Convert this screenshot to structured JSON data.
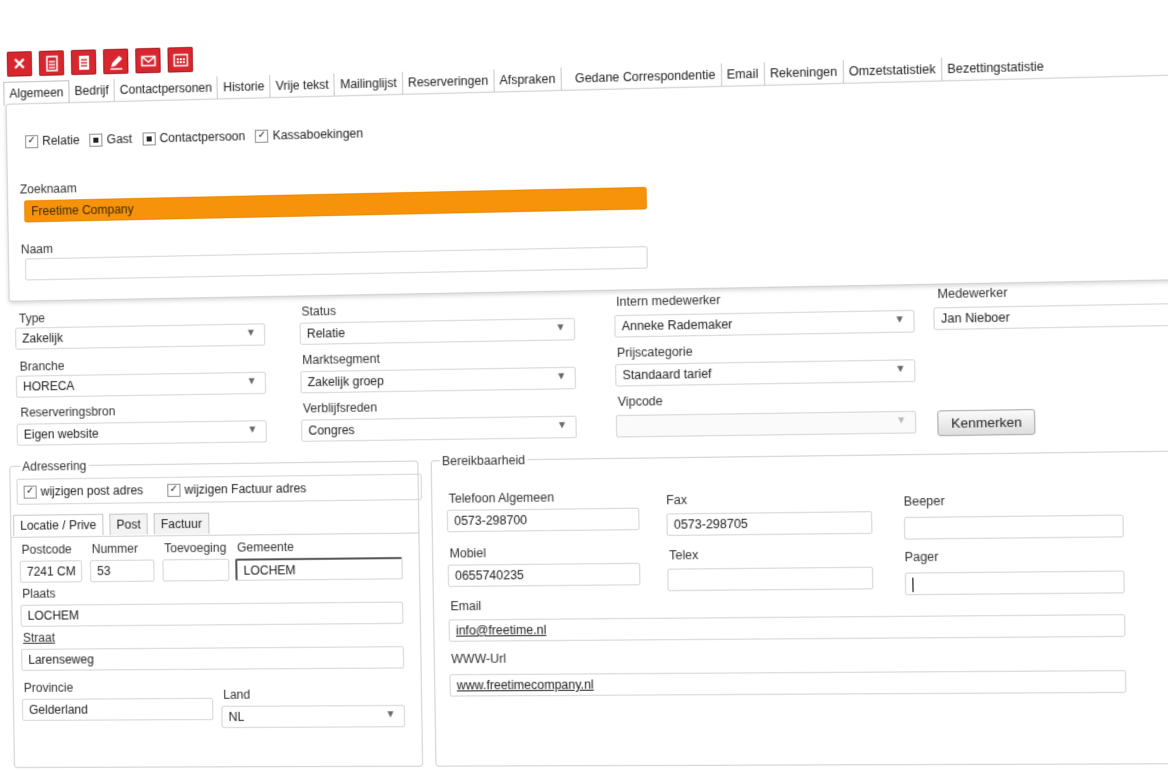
{
  "toolbar": {
    "buttons": [
      {
        "icon": "close-icon"
      },
      {
        "icon": "document-icon"
      },
      {
        "icon": "document-lines-icon"
      },
      {
        "icon": "edit-icon"
      },
      {
        "icon": "email-icon"
      },
      {
        "icon": "calendar-icon"
      }
    ]
  },
  "tabs": [
    "Algemeen",
    "Bedrijf",
    "Contactpersonen",
    "Historie",
    "Vrije tekst",
    "Mailinglijst",
    "Reserveringen",
    "Afspraken",
    "Gedane Correspondentie",
    "Email",
    "Rekeningen",
    "Omzetstatistiek",
    "Bezettingstatistie"
  ],
  "checks": {
    "relatie": {
      "label": "Relatie",
      "state": "checked"
    },
    "gast": {
      "label": "Gast",
      "state": "indeterminate"
    },
    "contactpersoon": {
      "label": "Contactpersoon",
      "state": "indeterminate"
    },
    "kassaboekingen": {
      "label": "Kassaboekingen",
      "state": "checked"
    }
  },
  "zoeknaam": {
    "label": "Zoeknaam",
    "value": "Freetime Company"
  },
  "naam": {
    "label": "Naam",
    "value": ""
  },
  "type": {
    "label": "Type",
    "value": "Zakelijk"
  },
  "status": {
    "label": "Status",
    "value": "Relatie"
  },
  "intern": {
    "label": "Intern medewerker",
    "value": "Anneke Rademaker"
  },
  "medewerker": {
    "label": "Medewerker",
    "value": "Jan Nieboer"
  },
  "branche": {
    "label": "Branche",
    "value": "HORECA"
  },
  "marktsegment": {
    "label": "Marktsegment",
    "value": "Zakelijk groep"
  },
  "prijscategorie": {
    "label": "Prijscategorie",
    "value": "Standaard tarief"
  },
  "reserveringsbron": {
    "label": "Reserveringsbron",
    "value": "Eigen website"
  },
  "verblijfsreden": {
    "label": "Verblijfsreden",
    "value": "Congres"
  },
  "vipcode": {
    "label": "Vipcode",
    "value": ""
  },
  "kenmerken_label": "Kenmerken",
  "adressering": {
    "title": "Adressering",
    "wijzigen_post": "wijzigen post adres",
    "wijzigen_factuur": "wijzigen Factuur adres",
    "subtabs": [
      "Locatie / Prive",
      "Post",
      "Factuur"
    ],
    "postcode": {
      "label": "Postcode",
      "value": "7241 CM"
    },
    "nummer": {
      "label": "Nummer",
      "value": "53"
    },
    "toevoeging": {
      "label": "Toevoeging",
      "value": ""
    },
    "gemeente": {
      "label": "Gemeente",
      "value": "LOCHEM"
    },
    "plaats": {
      "label": "Plaats",
      "value": "LOCHEM"
    },
    "straat": {
      "label": "Straat",
      "value": "Larenseweg"
    },
    "provincie": {
      "label": "Provincie",
      "value": "Gelderland"
    },
    "land": {
      "label": "Land",
      "value": "NL"
    }
  },
  "bereikbaarheid": {
    "title": "Bereikbaarheid",
    "telefoon": {
      "label": "Telefoon Algemeen",
      "value": "0573-298700"
    },
    "fax": {
      "label": "Fax",
      "value": "0573-298705"
    },
    "beeper": {
      "label": "Beeper",
      "value": ""
    },
    "mobiel": {
      "label": "Mobiel",
      "value": "0655740235"
    },
    "telex": {
      "label": "Telex",
      "value": ""
    },
    "pager": {
      "label": "Pager",
      "value": ""
    },
    "email": {
      "label": "Email",
      "value": "info@freetime.nl"
    },
    "www": {
      "label": "WWW-Url",
      "value": "www.freetimecompany.nl"
    }
  },
  "colors": {
    "accent": "#d7262e",
    "highlight": "#f7930a"
  }
}
